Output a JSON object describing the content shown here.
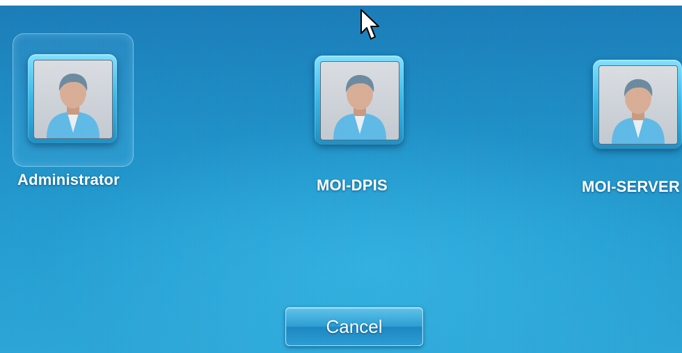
{
  "users": [
    {
      "name": "Administrator",
      "selected": true
    },
    {
      "name": "MOI-DPIS",
      "selected": false
    },
    {
      "name": "MOI-SERVER",
      "selected": false
    }
  ],
  "cancel_label": "Cancel",
  "icons": {
    "avatar": "user-avatar-icon",
    "cursor": "mouse-pointer-icon"
  },
  "colors": {
    "background": "#1e8fc6",
    "tile_frame": "#36b6e6",
    "text": "#ffffff"
  }
}
